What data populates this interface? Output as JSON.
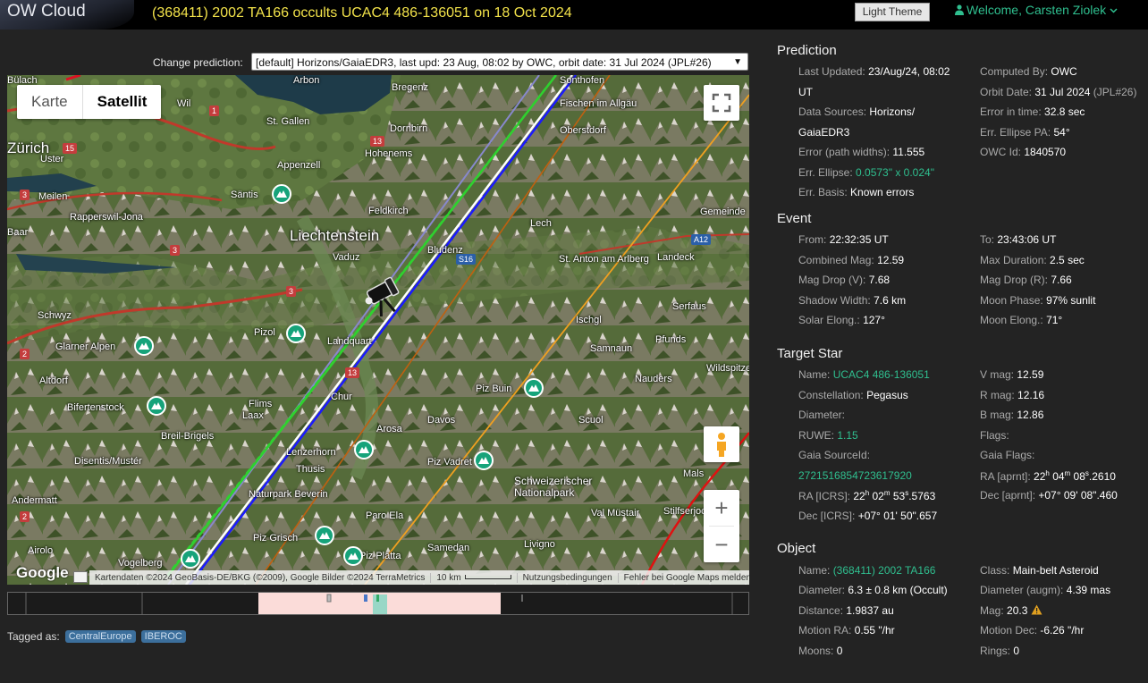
{
  "app": {
    "logo": "OW Cloud",
    "title": "(368411) 2002 TA166 occults UCAC4 486-136051 on 18 Oct 2024"
  },
  "header": {
    "theme_button": "Light Theme",
    "welcome": "Welcome, Carsten Ziolek"
  },
  "prediction_select": {
    "label": "Change prediction:",
    "value": "[default] Horizons/GaiaEDR3, last upd: 23 Aug, 08:02 by OWC, orbit date: 31 Jul 2024 (JPL#26)"
  },
  "map": {
    "tab_map": "Karte",
    "tab_satellite": "Satellit",
    "logo": "Google",
    "attribution": "Kartendaten ©2024 GeoBasis-DE/BKG (©2009), Google Bilder ©2024 TerraMetrics",
    "scale": "10 km",
    "terms": "Nutzungsbedingungen",
    "report": "Fehler bei Google Maps melden",
    "places": [
      {
        "name": "Bülach"
      },
      {
        "name": "Arbon"
      },
      {
        "name": "Bregenz"
      },
      {
        "name": "Sonthofen"
      },
      {
        "name": "Wil"
      },
      {
        "name": "St. Gallen"
      },
      {
        "name": "Fischen im Allgäu"
      },
      {
        "name": "Oberstdorf"
      },
      {
        "name": "Zürich"
      },
      {
        "name": "Uster"
      },
      {
        "name": "Dornbirn"
      },
      {
        "name": "Hohenems"
      },
      {
        "name": "Appenzell"
      },
      {
        "name": "Meilen"
      },
      {
        "name": "Säntis"
      },
      {
        "name": "Rapperswil-Jona"
      },
      {
        "name": "Feldkirch"
      },
      {
        "name": "Gemeinde"
      },
      {
        "name": "Baar"
      },
      {
        "name": "Liechtenstein"
      },
      {
        "name": "Bludenz"
      },
      {
        "name": "Lech"
      },
      {
        "name": "Vaduz"
      },
      {
        "name": "St. Anton am Arlberg"
      },
      {
        "name": "Landeck"
      },
      {
        "name": "Schwyz"
      },
      {
        "name": "Serfaus"
      },
      {
        "name": "Ischgl"
      },
      {
        "name": "Glarner Alpen"
      },
      {
        "name": "Pizol"
      },
      {
        "name": "Landquart"
      },
      {
        "name": "Samnaun"
      },
      {
        "name": "Pfunds"
      },
      {
        "name": "Altdorf"
      },
      {
        "name": "Nauders"
      },
      {
        "name": "Bifertenstock"
      },
      {
        "name": "Flims"
      },
      {
        "name": "Laax"
      },
      {
        "name": "Chur"
      },
      {
        "name": "Piz Buin"
      },
      {
        "name": "Breil-Brigels"
      },
      {
        "name": "Davos"
      },
      {
        "name": "Scuol"
      },
      {
        "name": "Arosa"
      },
      {
        "name": "Disentis/Mustér"
      },
      {
        "name": "Lenzerhorn"
      },
      {
        "name": "Piz Vadret"
      },
      {
        "name": "Thusis"
      },
      {
        "name": "Schweizerischer Nationalpark"
      },
      {
        "name": "Andermatt"
      },
      {
        "name": "Mals"
      },
      {
        "name": "Naturpark Beverin"
      },
      {
        "name": "Val Müstair"
      },
      {
        "name": "Stilfserjoch"
      },
      {
        "name": "Paro Ela"
      },
      {
        "name": "Airolo"
      },
      {
        "name": "Piz Grisch"
      },
      {
        "name": "Samedan"
      },
      {
        "name": "Vogelberg"
      },
      {
        "name": "Piz Platta"
      },
      {
        "name": "Livigno"
      },
      {
        "name": "Wildspitze"
      }
    ],
    "shields": [
      {
        "label": "1"
      },
      {
        "label": "15"
      },
      {
        "label": "13"
      },
      {
        "label": "3"
      },
      {
        "label": "3"
      },
      {
        "label": "A12"
      },
      {
        "label": "S16"
      },
      {
        "label": "3"
      },
      {
        "label": "2"
      },
      {
        "label": "13"
      },
      {
        "label": "2"
      }
    ]
  },
  "tags": {
    "label": "Tagged as:",
    "items": [
      "CentralEurope",
      "IBEROC"
    ]
  },
  "sections": {
    "prediction": "Prediction",
    "event": "Event",
    "target_star": "Target Star",
    "object": "Object"
  },
  "prediction": {
    "last_updated_k": "Last Updated:",
    "last_updated_v": "23/Aug/24, 08:02",
    "last_updated_v2": "UT",
    "computed_by_k": "Computed By:",
    "computed_by_v": "OWC",
    "orbit_date_k": "Orbit Date:",
    "orbit_date_v": "31 Jul 2024",
    "orbit_date_v2": "(JPL#26)",
    "sources_k": "Data Sources:",
    "sources_v": "Horizons/",
    "sources_v2": "GaiaEDR3",
    "err_time_k": "Error in time:",
    "err_time_v": "32.8 sec",
    "err_pa_k": "Err. Ellipse PA:",
    "err_pa_v": "54°",
    "err_path_k": "Error (path widths):",
    "err_path_v": "11.555",
    "owc_id_k": "OWC Id:",
    "owc_id_v": "1840570",
    "err_ellipse_k": "Err. Ellipse:",
    "err_ellipse_v": "0.0573\" x 0.024\"",
    "err_basis_k": "Err. Basis:",
    "err_basis_v": "Known errors"
  },
  "event": {
    "from_k": "From:",
    "from_v": "22:32:35 UT",
    "to_k": "To:",
    "to_v": "23:43:06 UT",
    "comb_mag_k": "Combined Mag:",
    "comb_mag_v": "12.59",
    "max_dur_k": "Max Duration:",
    "max_dur_v": "2.5 sec",
    "drop_v_k": "Mag Drop (V):",
    "drop_v_v": "7.68",
    "drop_r_k": "Mag Drop (R):",
    "drop_r_v": "7.66",
    "shadow_k": "Shadow Width:",
    "shadow_v": "7.6 km",
    "moon_phase_k": "Moon Phase:",
    "moon_phase_v": "97% sunlit",
    "solar_k": "Solar Elong.:",
    "solar_v": "127°",
    "moon_el_k": "Moon Elong.:",
    "moon_el_v": "71°"
  },
  "star": {
    "name_k": "Name:",
    "name_v": "UCAC4 486-136051",
    "vmag_k": "V mag:",
    "vmag_v": "12.59",
    "const_k": "Constellation:",
    "const_v": "Pegasus",
    "rmag_k": "R mag:",
    "rmag_v": "12.16",
    "diam_k": "Diameter:",
    "bmag_k": "B mag:",
    "bmag_v": "12.86",
    "ruwe_k": "RUWE:",
    "ruwe_v": "1.15",
    "flags_k": "Flags:",
    "source_k": "Gaia SourceId:",
    "source_v": "2721516854723617920",
    "gflags_k": "Gaia Flags:",
    "ra_ap_k": "RA [aprnt]:",
    "ra_ap_v": "22h 04m 08s.2610",
    "ra_icrs_k": "RA [ICRS]:",
    "ra_icrs_v": "22h 02m 53s.5763",
    "dec_ap_k": "Dec [aprnt]:",
    "dec_ap_v": "+07° 09' 08\".460",
    "dec_icrs_k": "Dec [ICRS]:",
    "dec_icrs_v": "+07° 01' 50\".657"
  },
  "object": {
    "name_k": "Name:",
    "name_v": "(368411) 2002 TA166",
    "class_k": "Class:",
    "class_v": "Main-belt Asteroid",
    "diam_k": "Diameter:",
    "diam_v": "6.3 ± 0.8 km",
    "diam_v2": "(Occult)",
    "diam_a_k": "Diameter (augm):",
    "diam_a_v": "4.39 mas",
    "dist_k": "Distance:",
    "dist_v": "1.9837 au",
    "mag_k": "Mag:",
    "mag_v": "20.3",
    "mra_k": "Motion RA:",
    "mra_v": "0.55 \"/hr",
    "mdec_k": "Motion Dec:",
    "mdec_v": "-6.26 \"/hr",
    "moons_k": "Moons:",
    "moons_v": "0",
    "rings_k": "Rings:",
    "rings_v": "0"
  },
  "colors": {
    "accent": "#2fbf8f",
    "title": "#f2e24a",
    "path_center": "#2fd12f",
    "path_edge": "#1a1aff",
    "path_error": "#8888ff"
  }
}
